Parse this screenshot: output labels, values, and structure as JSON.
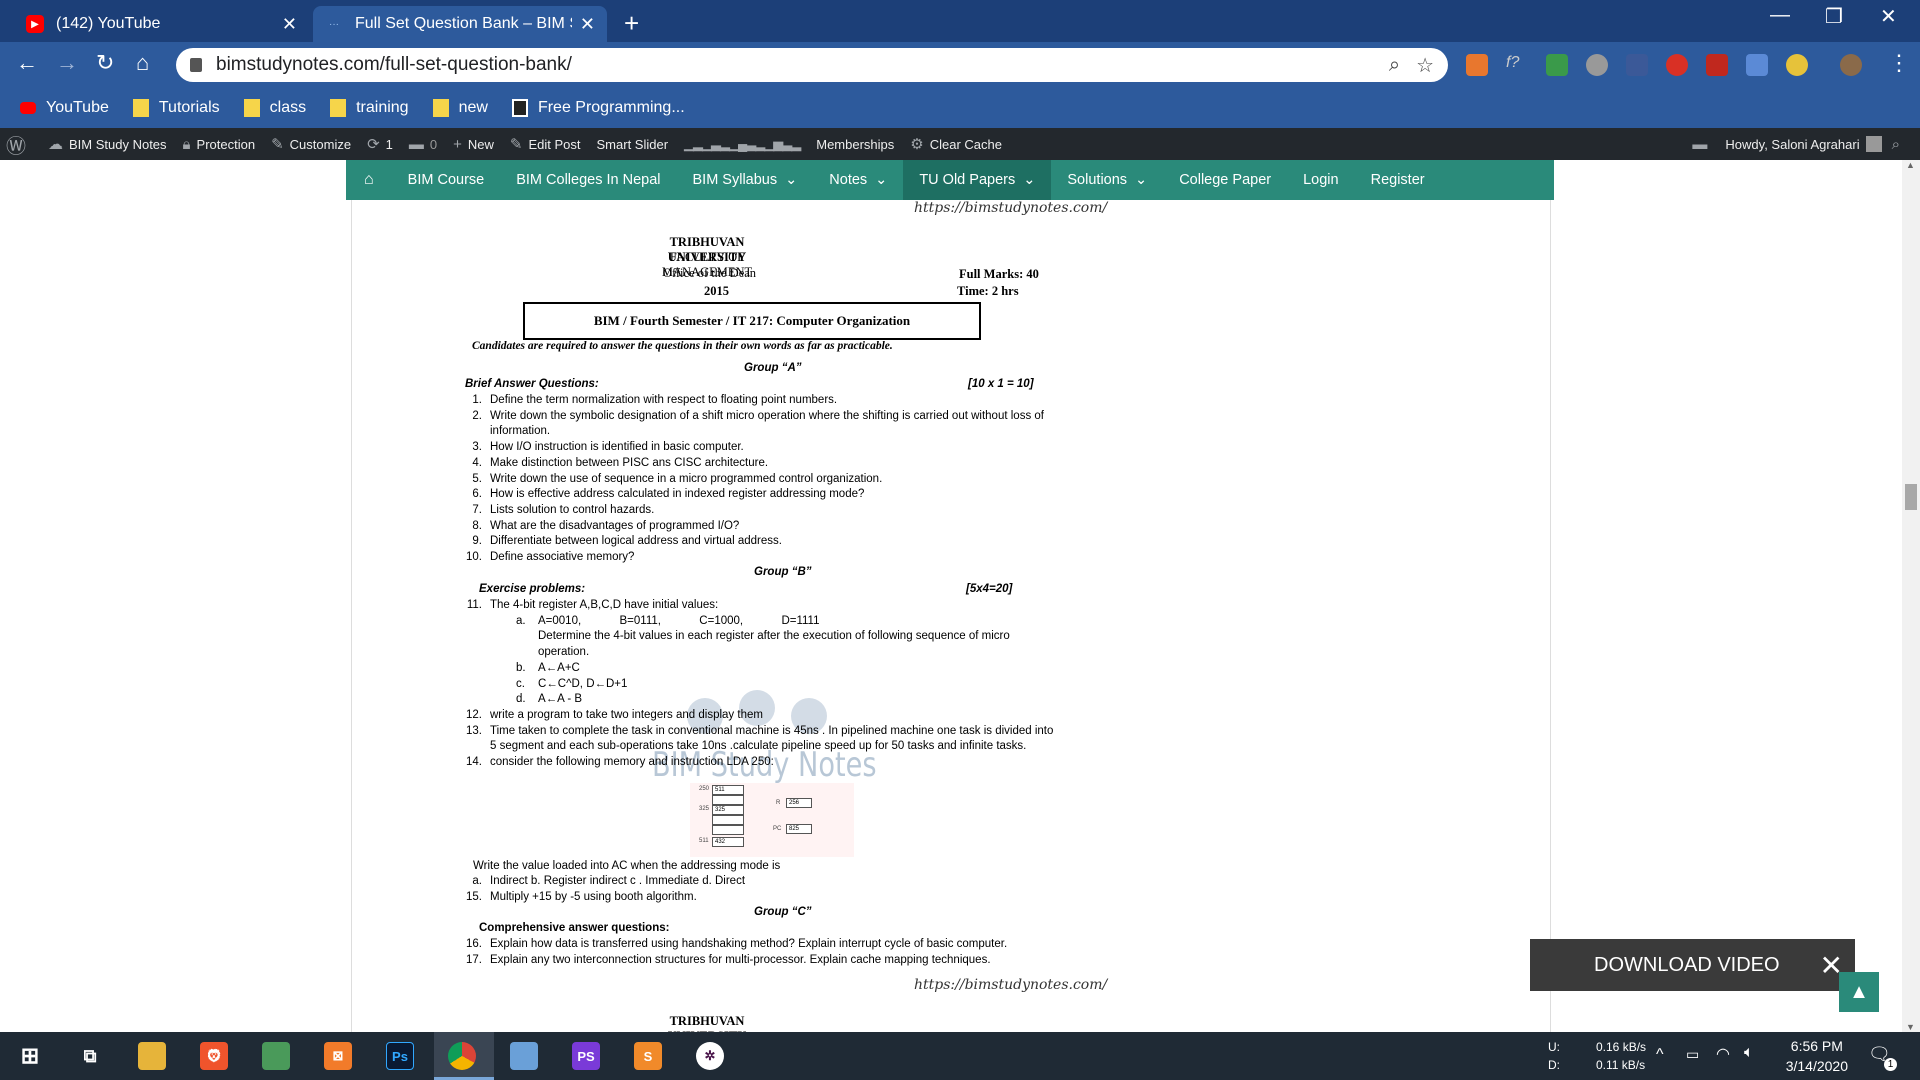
{
  "browser": {
    "tabs": [
      {
        "title": "(142) YouTube",
        "active": false
      },
      {
        "title": "Full Set Question Bank – BIM Stu",
        "active": true
      }
    ],
    "url": "bimstudynotes.com/full-set-question-bank/",
    "bookmarks": [
      "YouTube",
      "Tutorials",
      "class",
      "training",
      "new",
      "Free Programming..."
    ]
  },
  "wp_admin_bar": {
    "site": "BIM Study Notes",
    "protection": "Protection",
    "customize": "Customize",
    "updates": "1",
    "comments": "0",
    "new": "New",
    "edit_post": "Edit Post",
    "smart_slider": "Smart Slider",
    "memberships": "Memberships",
    "clear_cache": "Clear Cache",
    "howdy": "Howdy, Saloni Agrahari"
  },
  "site_nav": [
    "BIM Course",
    "BIM Colleges In Nepal",
    "BIM Syllabus",
    "Notes",
    "TU Old Papers",
    "Solutions",
    "College Paper",
    "Login",
    "Register"
  ],
  "paper": {
    "site_url": "https://bimstudynotes.com/",
    "university": "TRIBHUVAN UNIVERSITY",
    "faculty": "FACULTY OF MANAGEMENT",
    "office": "Office of the Dean",
    "year": "2015",
    "full_marks": "Full Marks: 40",
    "time": "Time: 2 hrs",
    "subject": "BIM / Fourth Semester / IT 217: Computer Organization",
    "instruction": "Candidates are required to answer the questions in their own words as far as practicable.",
    "group_a": "Group “A”",
    "brief_label": "Brief Answer Questions:",
    "brief_marks": "[10 x 1 = 10]",
    "brief_questions": [
      {
        "n": "1.",
        "t": "Define the term normalization with respect to floating point numbers."
      },
      {
        "n": "2.",
        "t": "Write down the symbolic designation of a shift micro operation where the shifting is carried out without loss of"
      },
      {
        "n": "",
        "t": "information."
      },
      {
        "n": "3.",
        "t": "How I/O instruction is identified in basic computer."
      },
      {
        "n": "4.",
        "t": "Make distinction between PISC ans CISC architecture."
      },
      {
        "n": "5.",
        "t": "Write down the use of sequence in a micro programmed control organization."
      },
      {
        "n": "6.",
        "t": "How is effective address calculated in indexed register addressing mode?"
      },
      {
        "n": "7.",
        "t": "Lists solution to control hazards."
      },
      {
        "n": "8.",
        "t": "What are the disadvantages of programmed I/O?"
      },
      {
        "n": "9.",
        "t": "Differentiate between logical address and virtual address."
      },
      {
        "n": "10.",
        "t": "Define associative memory?"
      }
    ],
    "group_b": "Group “B”",
    "exercise_label": "Exercise problems:",
    "exercise_marks": "[5x4=20]",
    "q11": "The 4-bit register A,B,C,D have initial values:",
    "q11a_label": "a.",
    "q11a": "A=0010,            B=0111,            C=1000,            D=1111",
    "q11a_cont1": "Determine the 4-bit values in each register after the execution of following sequence of micro",
    "q11a_cont2": "operation.",
    "q11b": "A←A+C",
    "q11c": "C←C^D, D←D+1",
    "q11d": "A←A - B",
    "q12": "write a program to take two integers and display them",
    "q13_line1": "Time taken to complete the task in conventional machine is 45ns . In pipelined machine one task is divided into",
    "q13_line2": "5 segment and each sub-operations take 10ns .calculate pipeline speed up for 50 tasks and infinite tasks.",
    "q14": "consider the following memory and instruction LDA 250:",
    "mem": {
      "addr1": "250",
      "val1": "511",
      "addr2": "325",
      "val2": "325",
      "addr3": "511",
      "val3": "432",
      "r_label": "R",
      "r_val": "256",
      "pc_label": "PC",
      "pc_val": "825"
    },
    "ac_question": "Write the value loaded into AC when the addressing mode is",
    "ac_options": "Indirect b. Register indirect c . Immediate d. Direct",
    "q15": "Multiply +15 by -5 using booth algorithm.",
    "group_c": "Group “C”",
    "comp_label": "Comprehensive answer questions:",
    "q16": "Explain how data is transferred using handshaking method? Explain interrupt cycle of basic computer.",
    "q17": "Explain any two interconnection structures for multi-processor. Explain cache mapping techniques.",
    "university_next": "TRIBHUVAN UNIVERSITY",
    "watermark": "BIM Study Notes"
  },
  "overlay": {
    "download_video": "DOWNLOAD VIDEO"
  },
  "taskbar": {
    "net_up_label": "U:",
    "net_down_label": "D:",
    "net_up": "0.16 kB/s",
    "net_down": "0.11 kB/s",
    "time": "6:56 PM",
    "date": "3/14/2020",
    "notifications": "1"
  }
}
